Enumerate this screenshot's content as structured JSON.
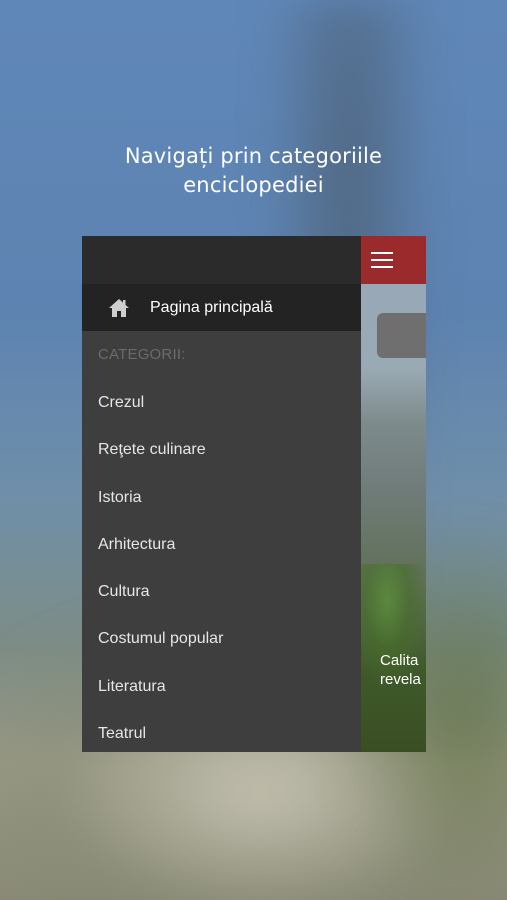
{
  "headline": {
    "line1": "Navigați prin categoriile",
    "line2": "enciclopediei"
  },
  "drawer": {
    "home_label": "Pagina principală",
    "home_icon": "home-icon",
    "section_label": "CATEGORII:",
    "items": [
      {
        "label": "Crezul"
      },
      {
        "label": "Reţete culinare"
      },
      {
        "label": "Istoria"
      },
      {
        "label": "Arhitectura"
      },
      {
        "label": "Cultura"
      },
      {
        "label": "Costumul popular"
      },
      {
        "label": "Literatura"
      },
      {
        "label": "Teatrul"
      }
    ]
  },
  "main": {
    "menu_icon": "hamburger-menu-icon",
    "header_color": "#9b2a2c",
    "caption_line1": "Calita",
    "caption_line2": "revela"
  }
}
